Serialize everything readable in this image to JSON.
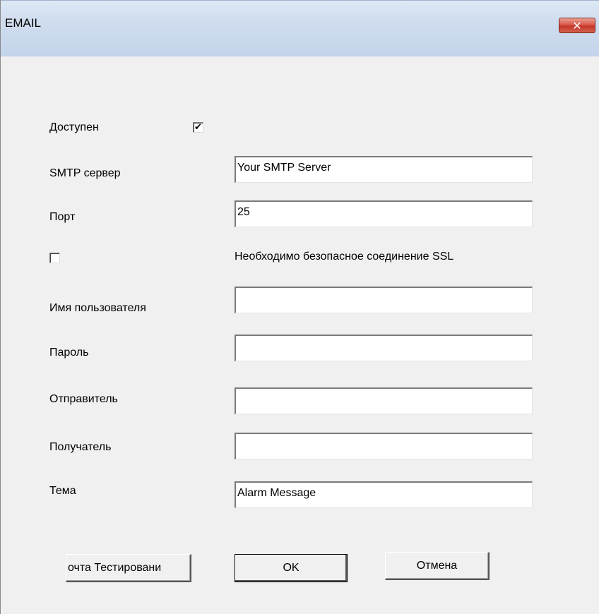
{
  "window": {
    "title": "EMAIL",
    "close_glyph": "✕"
  },
  "form": {
    "enabled": {
      "label": "Доступен",
      "checked": true,
      "glyph": "✔"
    },
    "smtp_server": {
      "label": "SMTP сервер",
      "value": "Your SMTP Server"
    },
    "port": {
      "label": "Порт",
      "value": "25"
    },
    "ssl": {
      "label": "Необходимо безопасное соединение SSL",
      "checked": false
    },
    "username": {
      "label": "Имя пользователя",
      "value": ""
    },
    "password": {
      "label": "Пароль",
      "value": ""
    },
    "sender": {
      "label": "Отправитель",
      "value": ""
    },
    "recipient": {
      "label": "Получатель",
      "value": ""
    },
    "subject": {
      "label": "Тема",
      "value": "Alarm Message"
    }
  },
  "buttons": {
    "test_label": "очта Тестировани",
    "ok_label": "OK",
    "cancel_label": "Отмена"
  },
  "icons": {
    "close": "close-icon",
    "check": "checkmark-icon"
  },
  "colors": {
    "titlebar": "#c3d4ea",
    "close_button": "#d9594a",
    "dialog_bg": "#f0f0f0"
  }
}
